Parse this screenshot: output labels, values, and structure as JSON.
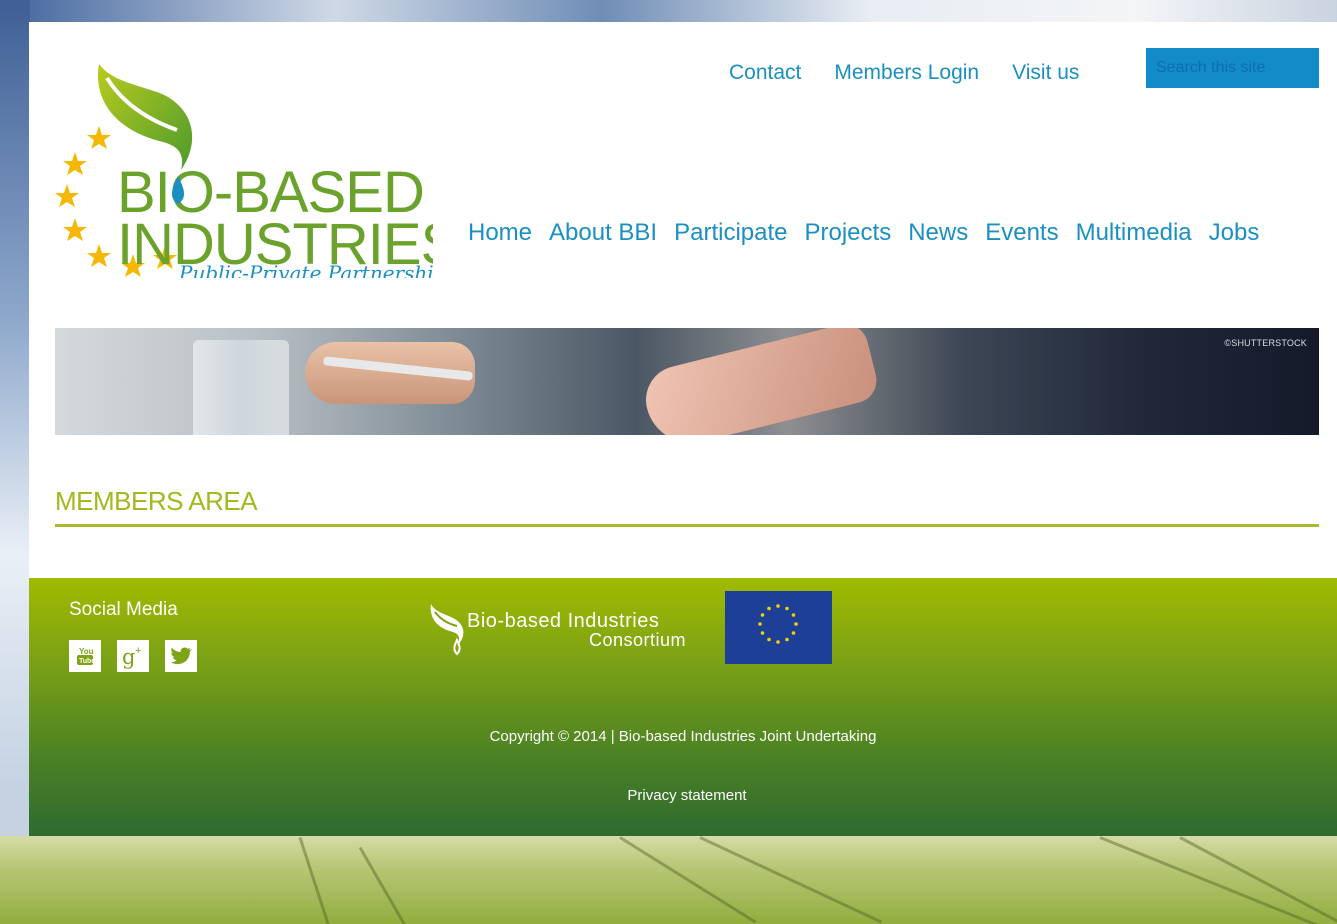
{
  "logo": {
    "line1": "BIO-BASED",
    "line2": "INDUSTRIES",
    "tagline": "Public-Private Partnership"
  },
  "top_links": [
    "Contact",
    "Members Login",
    "Visit us"
  ],
  "search": {
    "placeholder": "Search this site"
  },
  "main_nav": [
    "Home",
    "About BBI",
    "Participate",
    "Projects",
    "News",
    "Events",
    "Multimedia",
    "Jobs"
  ],
  "banner": {
    "credit": "©SHUTTERSTOCK"
  },
  "page_title": "MEMBERS AREA",
  "footer": {
    "social_title": "Social Media",
    "social_icons": [
      "youtube-icon",
      "google-plus-icon",
      "twitter-icon"
    ],
    "consortium_line1": "Bio-based Industries",
    "consortium_line2": "Consortium",
    "copyright": "Copyright © 2014 | Bio-based Industries Joint Undertaking",
    "privacy": "Privacy statement"
  },
  "colors": {
    "link_blue": "#1a8fc2",
    "title_green": "#a3b81e",
    "footer_top": "#a0bb00",
    "footer_bottom": "#2f6a30",
    "search_bg": "#148bc9",
    "eu_blue": "#1e3f97",
    "star_yellow": "#f5b700"
  }
}
